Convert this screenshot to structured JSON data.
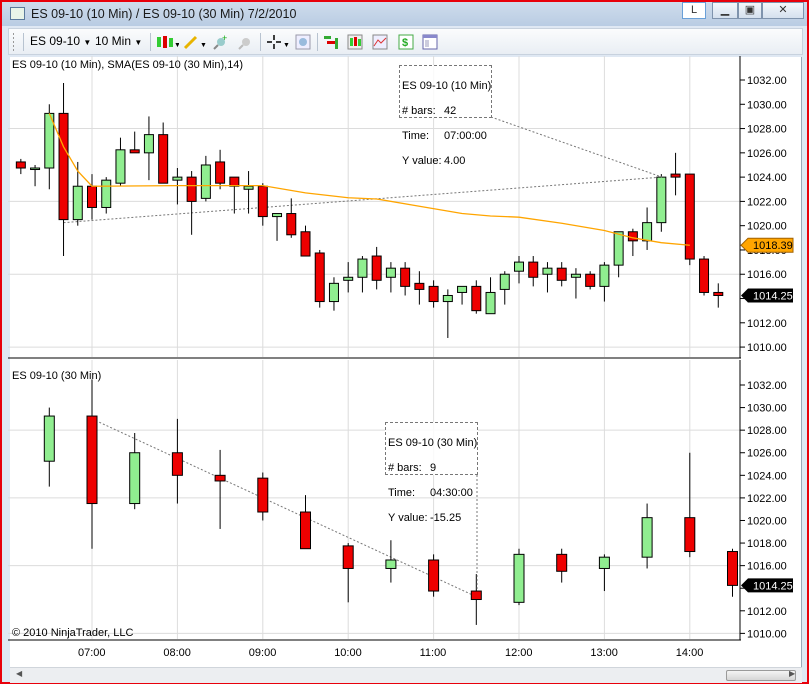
{
  "window": {
    "title": "ES 09-10 (10 Min) / ES 09-10 (30 Min)  7/2/2010",
    "buttons": {
      "l": "L",
      "minimize": "minimize-icon",
      "maximize": "maximize-icon",
      "close": "close-icon"
    }
  },
  "toolbar": {
    "instrument": "ES 09-10",
    "interval": "10 Min",
    "icons": [
      "candlestick-style-icon",
      "pencil-draw-icon",
      "zoom-in-icon",
      "zoom-out-icon",
      "crosshair-icon",
      "magnifier-icon",
      "strategies-icon",
      "indicators-icon",
      "chart-properties-icon",
      "dollar-icon",
      "data-box-icon"
    ]
  },
  "panels": {
    "top_title": "ES 09-10 (10 Min), SMA(ES 09-10 (30 Min),14)",
    "bottom_title": "ES 09-10 (30 Min)",
    "copyright": "© 2010 NinjaTrader, LLC"
  },
  "tooltips": {
    "top": {
      "title": "ES 09-10 (10 Min)",
      "bars_label": "# bars:",
      "bars": "42",
      "time_label": "Time:",
      "time": "07:00:00",
      "y_label": "Y value:",
      "y": "4.00"
    },
    "bottom": {
      "title": "ES 09-10 (30 Min)",
      "bars_label": "# bars:",
      "bars": "9",
      "time_label": "Time:",
      "time": "04:30:00",
      "y_label": "Y value:",
      "y": "-15.25"
    }
  },
  "colors": {
    "up": "#90ee90",
    "down": "#ee0000",
    "sma": "#ffa500",
    "last_price_tag": "#000000",
    "sma_tag": "#ffa500",
    "window_border": "#e8000b"
  },
  "chart_data": [
    {
      "type": "candlestick",
      "title": "ES 09-10 (10 Min)",
      "ylim": [
        1009,
        1033
      ],
      "yticks": [
        "1010.00",
        "1012.00",
        "1014.00",
        "1016.00",
        "1018.00",
        "1020.00",
        "1022.00",
        "1024.00",
        "1026.00",
        "1028.00",
        "1030.00",
        "1032.00"
      ],
      "xticks": [
        "07:00",
        "08:00",
        "09:00",
        "10:00",
        "11:00",
        "12:00",
        "13:00",
        "14:00"
      ],
      "grid": true,
      "fields": [
        "time",
        "open",
        "high",
        "low",
        "close"
      ],
      "bars": [
        [
          "06:10",
          1025.25,
          1025.5,
          1024.25,
          1024.75
        ],
        [
          "06:20",
          1024.75,
          1025.0,
          1023.25,
          1024.75
        ],
        [
          "06:30",
          1024.75,
          1030.0,
          1023.0,
          1029.25
        ],
        [
          "06:40",
          1029.25,
          1031.75,
          1017.5,
          1020.5
        ],
        [
          "06:50",
          1020.5,
          1025.25,
          1020.0,
          1023.25
        ],
        [
          "07:00",
          1023.25,
          1024.25,
          1020.5,
          1021.5
        ],
        [
          "07:10",
          1021.5,
          1024.0,
          1021.0,
          1023.75
        ],
        [
          "07:20",
          1023.5,
          1027.25,
          1023.25,
          1026.25
        ],
        [
          "07:30",
          1026.25,
          1027.75,
          1026.0,
          1026.0
        ],
        [
          "07:40",
          1026.0,
          1029.0,
          1023.75,
          1027.5
        ],
        [
          "07:50",
          1027.5,
          1028.5,
          1023.5,
          1023.5
        ],
        [
          "08:00",
          1023.75,
          1024.75,
          1021.75,
          1024.0
        ],
        [
          "08:10",
          1024.0,
          1024.5,
          1019.25,
          1022.0
        ],
        [
          "08:20",
          1022.25,
          1025.75,
          1022.0,
          1025.0
        ],
        [
          "08:30",
          1025.25,
          1026.25,
          1023.0,
          1023.5
        ],
        [
          "08:40",
          1024.0,
          1024.0,
          1021.0,
          1023.25
        ],
        [
          "08:50",
          1023.0,
          1024.5,
          1021.0,
          1023.25
        ],
        [
          "09:00",
          1023.25,
          1023.5,
          1020.0,
          1020.75
        ],
        [
          "09:10",
          1020.75,
          1021.0,
          1018.75,
          1021.0
        ],
        [
          "09:20",
          1021.0,
          1022.25,
          1019.0,
          1019.25
        ],
        [
          "09:30",
          1019.5,
          1020.0,
          1017.5,
          1017.5
        ],
        [
          "09:40",
          1017.75,
          1018.0,
          1013.25,
          1013.75
        ],
        [
          "09:50",
          1013.75,
          1015.75,
          1013.0,
          1015.25
        ],
        [
          "10:00",
          1015.5,
          1017.0,
          1014.5,
          1015.75
        ],
        [
          "10:10",
          1015.75,
          1017.5,
          1014.5,
          1017.25
        ],
        [
          "10:20",
          1017.5,
          1018.25,
          1014.75,
          1015.5
        ],
        [
          "10:30",
          1015.75,
          1017.0,
          1014.5,
          1016.5
        ],
        [
          "10:40",
          1016.5,
          1017.0,
          1014.25,
          1015.0
        ],
        [
          "10:50",
          1015.25,
          1016.25,
          1013.5,
          1014.75
        ],
        [
          "11:00",
          1015.0,
          1015.5,
          1013.25,
          1013.75
        ],
        [
          "11:10",
          1013.75,
          1014.75,
          1010.75,
          1014.25
        ],
        [
          "11:20",
          1014.5,
          1015.0,
          1013.5,
          1015.0
        ],
        [
          "11:30",
          1015.0,
          1015.5,
          1012.75,
          1013.0
        ],
        [
          "11:40",
          1012.75,
          1015.75,
          1012.75,
          1014.5
        ],
        [
          "11:50",
          1014.75,
          1016.25,
          1013.5,
          1016.0
        ],
        [
          "12:00",
          1016.25,
          1017.5,
          1015.25,
          1017.0
        ],
        [
          "12:10",
          1017.0,
          1017.5,
          1015.0,
          1015.75
        ],
        [
          "12:20",
          1016.0,
          1017.0,
          1014.5,
          1016.5
        ],
        [
          "12:30",
          1016.5,
          1017.0,
          1015.0,
          1015.5
        ],
        [
          "12:40",
          1015.75,
          1016.5,
          1014.0,
          1016.0
        ],
        [
          "12:50",
          1016.0,
          1016.25,
          1014.75,
          1015.0
        ],
        [
          "13:00",
          1015.0,
          1017.0,
          1013.75,
          1016.75
        ],
        [
          "13:10",
          1016.75,
          1019.5,
          1015.75,
          1019.5
        ],
        [
          "13:20",
          1019.5,
          1019.75,
          1017.5,
          1018.75
        ],
        [
          "13:30",
          1018.75,
          1021.5,
          1018.0,
          1020.25
        ],
        [
          "13:40",
          1020.25,
          1024.25,
          1019.5,
          1024.0
        ],
        [
          "13:50",
          1024.25,
          1026.0,
          1022.5,
          1024.0
        ],
        [
          "14:00",
          1024.25,
          1024.25,
          1016.75,
          1017.25
        ],
        [
          "14:10",
          1017.25,
          1017.5,
          1014.25,
          1014.5
        ],
        [
          "14:20",
          1014.5,
          1015.25,
          1013.25,
          1014.25
        ]
      ],
      "sma": {
        "name": "SMA(ES 09-10 (30 Min),14)",
        "points": [
          [
            "06:30",
            1029.25
          ],
          [
            "06:40",
            1026.5
          ],
          [
            "06:50",
            1024.5
          ],
          [
            "07:00",
            1023.25
          ],
          [
            "08:00",
            1023.3
          ],
          [
            "09:00",
            1023.3
          ],
          [
            "09:30",
            1022.7
          ],
          [
            "10:00",
            1022.3
          ],
          [
            "10:20",
            1022.2
          ],
          [
            "10:50",
            1021.6
          ],
          [
            "11:20",
            1021.0
          ],
          [
            "11:40",
            1020.8
          ],
          [
            "12:00",
            1020.7
          ],
          [
            "12:30",
            1020.2
          ],
          [
            "13:00",
            1019.6
          ],
          [
            "13:20",
            1019.0
          ],
          [
            "13:40",
            1018.6
          ],
          [
            "14:00",
            1018.39
          ]
        ],
        "last_value": "1018.39"
      },
      "last_price": "1014.25",
      "drawing": {
        "from": [
          "06:40",
          1020.25
        ],
        "to": [
          "13:40",
          1024.0
        ]
      }
    },
    {
      "type": "candlestick",
      "title": "ES 09-10 (30 Min)",
      "ylim": [
        1009,
        1033
      ],
      "yticks": [
        "1010.00",
        "1012.00",
        "1014.00",
        "1016.00",
        "1018.00",
        "1020.00",
        "1022.00",
        "1024.00",
        "1026.00",
        "1028.00",
        "1030.00",
        "1032.00"
      ],
      "xticks": [
        "07:00",
        "08:00",
        "09:00",
        "10:00",
        "11:00",
        "12:00",
        "13:00",
        "14:00"
      ],
      "grid": true,
      "fields": [
        "time",
        "open",
        "high",
        "low",
        "close"
      ],
      "bars": [
        [
          "06:30",
          1025.25,
          1030.0,
          1023.0,
          1029.25
        ],
        [
          "07:00",
          1029.25,
          1032.5,
          1017.5,
          1021.5
        ],
        [
          "07:30",
          1021.5,
          1027.75,
          1021.0,
          1026.0
        ],
        [
          "08:00",
          1026.0,
          1029.0,
          1021.5,
          1024.0
        ],
        [
          "08:30",
          1024.0,
          1026.25,
          1019.25,
          1023.5
        ],
        [
          "09:00",
          1023.75,
          1024.25,
          1020.0,
          1020.75
        ],
        [
          "09:30",
          1020.75,
          1022.25,
          1017.5,
          1017.5
        ],
        [
          "10:00",
          1017.75,
          1018.0,
          1012.75,
          1015.75
        ],
        [
          "10:30",
          1015.75,
          1018.25,
          1014.5,
          1016.5
        ],
        [
          "11:00",
          1016.5,
          1017.0,
          1013.25,
          1013.75
        ],
        [
          "11:30",
          1013.75,
          1015.25,
          1010.75,
          1013.0
        ],
        [
          "12:00",
          1012.75,
          1017.5,
          1012.5,
          1017.0
        ],
        [
          "12:30",
          1017.0,
          1017.5,
          1014.5,
          1015.5
        ],
        [
          "13:00",
          1015.75,
          1017.0,
          1013.75,
          1016.75
        ],
        [
          "13:30",
          1016.75,
          1021.5,
          1015.75,
          1020.25
        ],
        [
          "14:00",
          1020.25,
          1026.0,
          1016.75,
          1017.25
        ],
        [
          "14:30",
          1017.25,
          1017.5,
          1013.25,
          1014.25
        ]
      ],
      "last_price": "1014.25",
      "drawing": {
        "from": [
          "07:00",
          1029.0
        ],
        "to": [
          "11:30",
          1013.25
        ]
      }
    }
  ]
}
